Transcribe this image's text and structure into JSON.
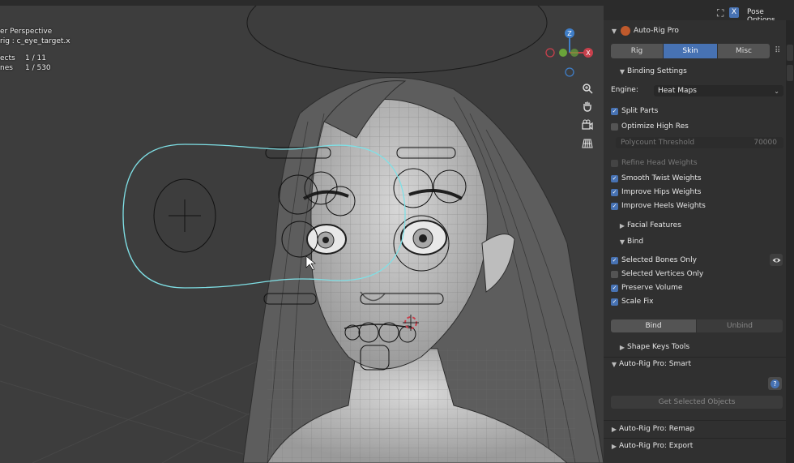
{
  "hud": {
    "line1": "er Perspective",
    "line2": "rig : c_eye_target.x",
    "objects_label": "ects",
    "objects_value": "1 / 11",
    "bones_label": "nes",
    "bones_value": "1 / 530"
  },
  "nav": {
    "axis_z": "Z",
    "axis_x": "X",
    "zoom_icon": "zoom-icon",
    "pan_icon": "hand-icon",
    "camera_icon": "camera-icon",
    "grid_icon": "grid-icon"
  },
  "header": {
    "x_badge": "X",
    "pose_options": "Pose Options"
  },
  "panel": {
    "title": "Auto-Rig Pro",
    "tabs": [
      {
        "label": "Rig",
        "active": false
      },
      {
        "label": "Skin",
        "active": true
      },
      {
        "label": "Misc",
        "active": false
      }
    ],
    "binding_settings": "Binding Settings",
    "engine_label": "Engine:",
    "engine_value": "Heat Maps",
    "split_parts": "Split Parts",
    "optimize_high_res": "Optimize High Res",
    "polycount_label": "Polycount Threshold",
    "polycount_value": "70000",
    "refine_head": "Refine Head Weights",
    "smooth_twist": "Smooth Twist Weights",
    "improve_hips": "Improve Hips Weights",
    "improve_heels": "Improve Heels Weights",
    "facial_features": "Facial Features",
    "bind_header": "Bind",
    "selected_bones_only": "Selected Bones Only",
    "selected_vertices_only": "Selected Vertices Only",
    "preserve_volume": "Preserve Volume",
    "scale_fix": "Scale Fix",
    "bind_button": "Bind",
    "unbind_button": "Unbind",
    "shape_keys_tools": "Shape Keys Tools",
    "smart_header": "Auto-Rig Pro: Smart",
    "help_icon": "?",
    "get_selected_objects": "Get Selected Objects",
    "remap_header": "Auto-Rig Pro: Remap",
    "export_header": "Auto-Rig Pro: Export"
  },
  "colors": {
    "accent": "#4772b3",
    "panel_bg": "#303030",
    "viewport_bg": "#3d3d3d",
    "selection_outline": "#7fe0e6",
    "axis_x": "#c8404c",
    "axis_y": "#6aa33a",
    "axis_z": "#3f7ec8"
  }
}
